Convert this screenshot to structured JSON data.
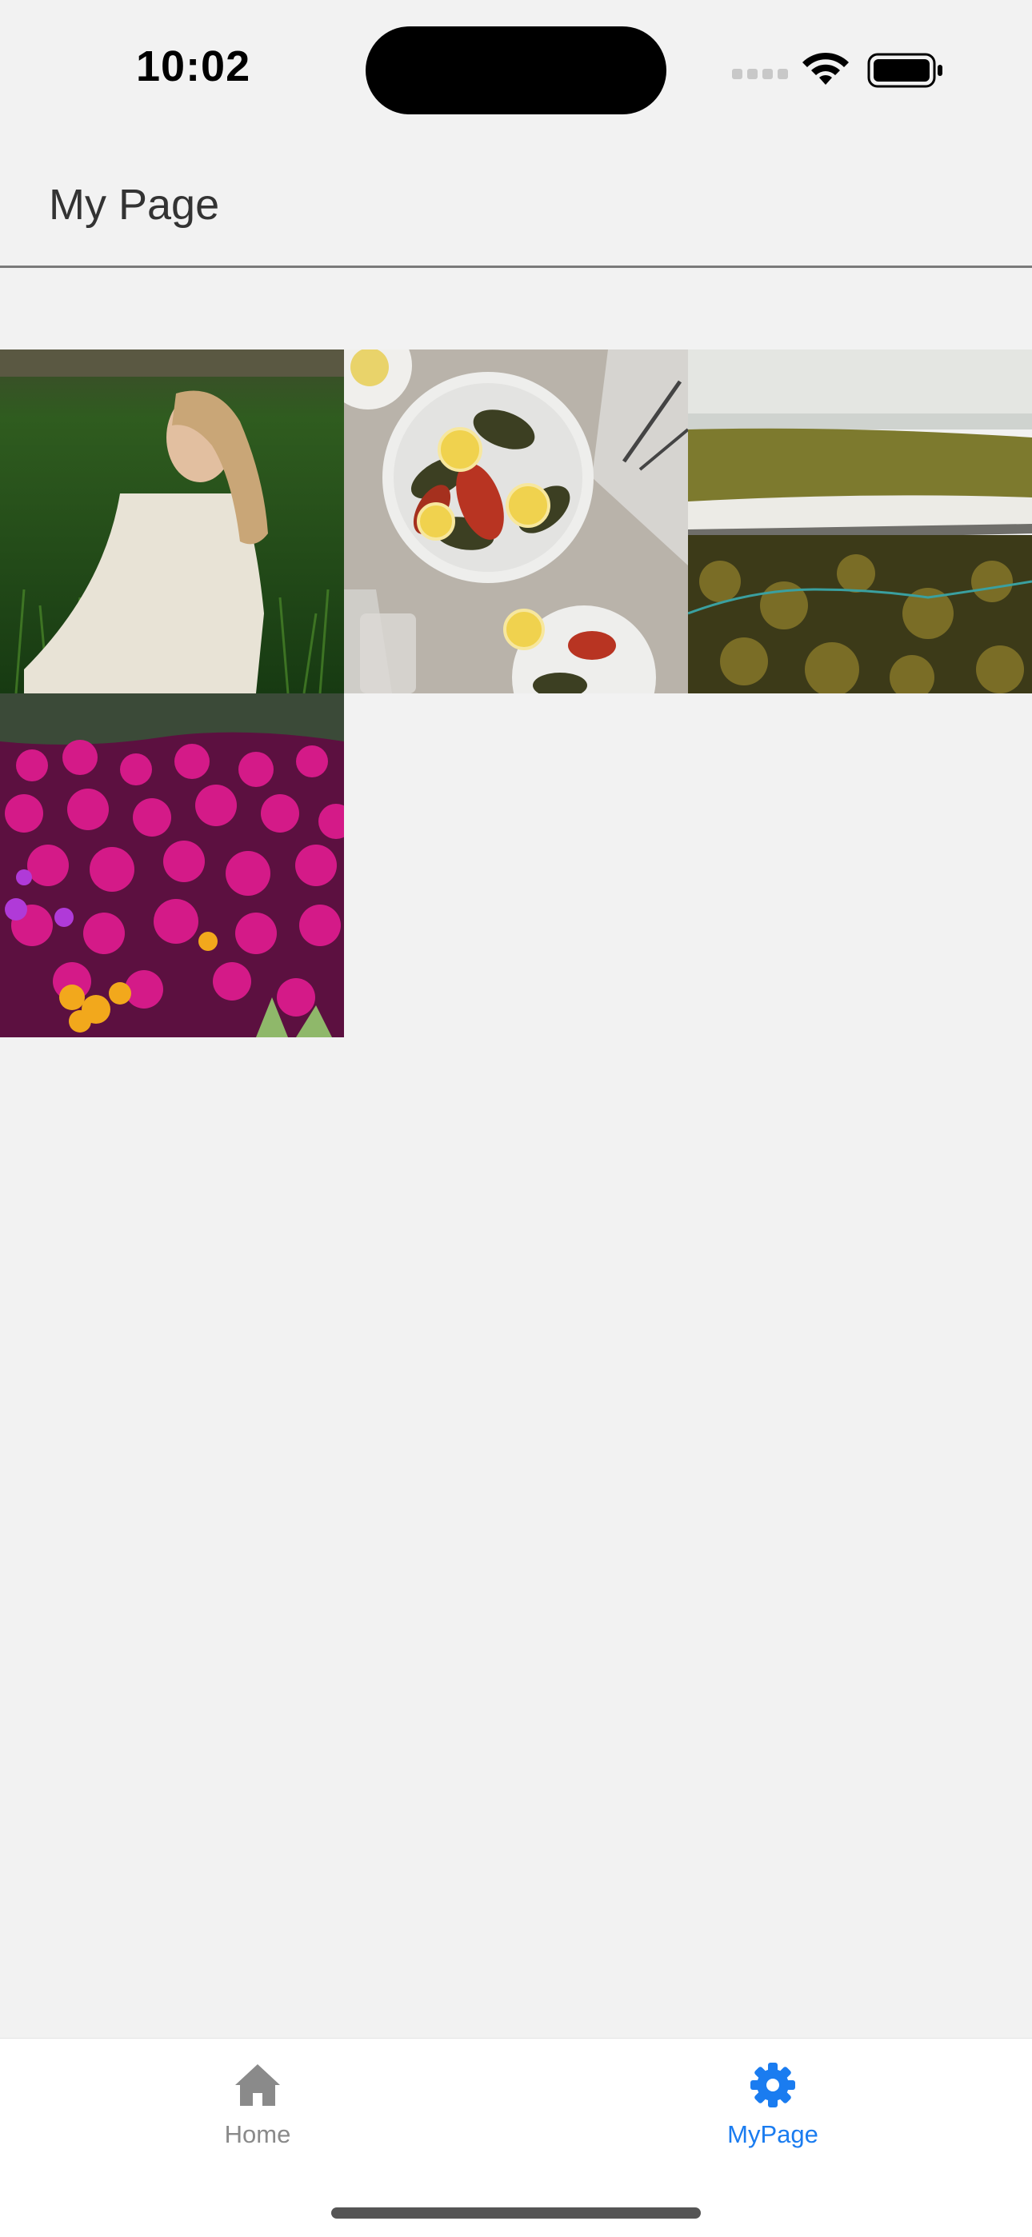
{
  "status_bar": {
    "time": "10:02",
    "icons": [
      "cellular-signal-icon",
      "wifi-icon",
      "battery-icon"
    ]
  },
  "header": {
    "title": "My Page"
  },
  "photos": [
    {
      "subject": "woman in white dress sitting in green grass field"
    },
    {
      "subject": "plates of stuffed grape leaves and grilled peppers with lemon slices"
    },
    {
      "subject": "surfboard on coastal succulent plants by the ocean"
    },
    {
      "subject": "magenta and orange ice plant flowers"
    }
  ],
  "tab_bar": {
    "tabs": [
      {
        "label": "Home",
        "icon": "house-icon",
        "selected": false
      },
      {
        "label": "MyPage",
        "icon": "gear-icon",
        "selected": true
      }
    ],
    "active_color": "#1a7cf0",
    "inactive_color": "#8a8a8a"
  }
}
